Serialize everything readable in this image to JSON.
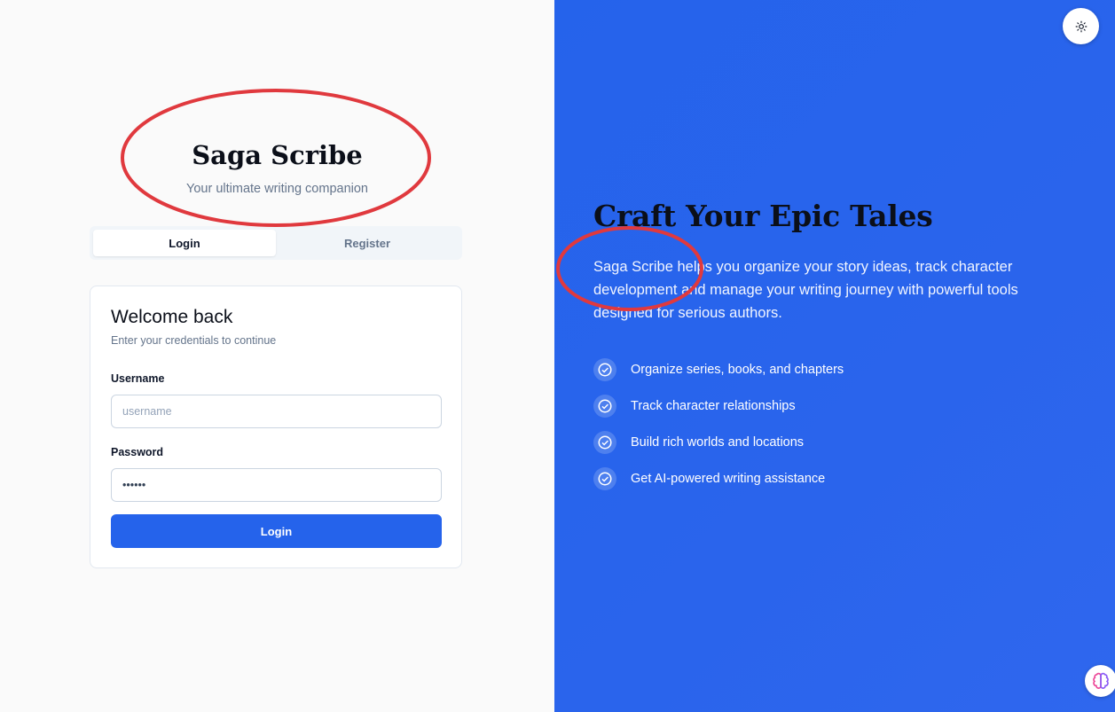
{
  "brand": {
    "title": "Saga Scribe",
    "subtitle": "Your ultimate writing companion"
  },
  "tabs": [
    {
      "label": "Login",
      "active": true
    },
    {
      "label": "Register",
      "active": false
    }
  ],
  "login_card": {
    "title": "Welcome back",
    "subtitle": "Enter your credentials to continue",
    "username_label": "Username",
    "username_placeholder": "username",
    "username_value": "",
    "password_label": "Password",
    "password_value": "••••••",
    "submit_label": "Login"
  },
  "hero": {
    "title": "Craft Your Epic Tales",
    "description": "Saga Scribe helps you organize your story ideas, track character development and manage your writing journey with powerful tools designed for serious authors.",
    "features": [
      "Organize series, books, and chapters",
      "Track character relationships",
      "Build rich worlds and locations",
      "Get AI-powered writing assistance"
    ]
  },
  "icons": {
    "theme_toggle": "sun-icon",
    "assistant": "brain-icon",
    "feature": "check-circle-icon"
  },
  "colors": {
    "accent": "#2563eb",
    "annotation": "#e0393e"
  }
}
